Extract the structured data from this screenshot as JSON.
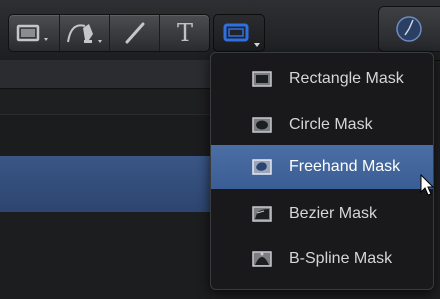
{
  "toolbar": {
    "text_tool_glyph": "T",
    "tools": [
      "rectangle-shape-tool",
      "pen-tool",
      "paint-stroke-tool",
      "text-tool"
    ]
  },
  "mask_menu": {
    "items": [
      {
        "label": "Rectangle Mask",
        "icon": "rectangle-mask-icon",
        "selected": false
      },
      {
        "label": "Circle Mask",
        "icon": "circle-mask-icon",
        "selected": false
      },
      {
        "label": "Freehand Mask",
        "icon": "freehand-mask-icon",
        "selected": true
      },
      {
        "label": "Bezier Mask",
        "icon": "bezier-mask-icon",
        "selected": false
      },
      {
        "label": "B-Spline Mask",
        "icon": "bspline-mask-icon",
        "selected": false
      }
    ]
  },
  "colors": {
    "accent_blue": "#2f6fe0",
    "selection": "#4568a0",
    "menu_bg": "#19191b"
  }
}
